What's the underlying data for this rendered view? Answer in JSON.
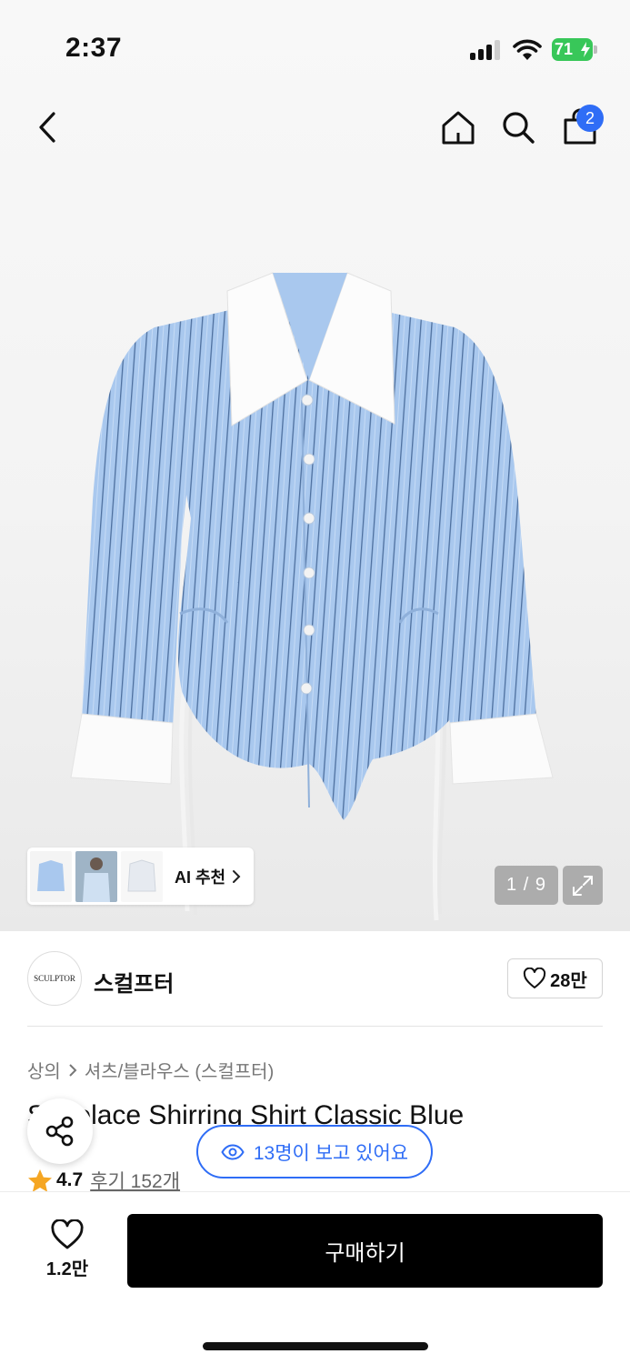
{
  "status_bar": {
    "time": "2:37",
    "battery": "71",
    "signal_icon": "cellular-signal-icon",
    "wifi_icon": "wifi-icon"
  },
  "header": {
    "back_icon": "chevron-left-icon",
    "home_icon": "home-icon",
    "search_icon": "search-icon",
    "cart_icon": "shopping-bag-icon",
    "cart_count": "2"
  },
  "gallery": {
    "ai_recommend_label": "AI 추천",
    "pager": "1 / 9",
    "expand_icon": "expand-icon"
  },
  "brand": {
    "logo_text": "SCULPTOR",
    "name": "스컬프터",
    "likes": "28만"
  },
  "breadcrumb": {
    "level1": "상의",
    "level2": "셔츠/블라우스 (스컬프터)"
  },
  "product": {
    "title": "Shoelace Shirring Shirt Classic Blue",
    "rating": "4.7",
    "reviews": "후기 152개",
    "viewers": "13명이 보고 있어요"
  },
  "bottom_bar": {
    "wish_count": "1.2만",
    "buy_label": "구매하기"
  },
  "colors": {
    "accent": "#2f6df6",
    "battery": "#38c759",
    "star": "#f5a623",
    "shirt_blue": "#a9c8ee"
  }
}
